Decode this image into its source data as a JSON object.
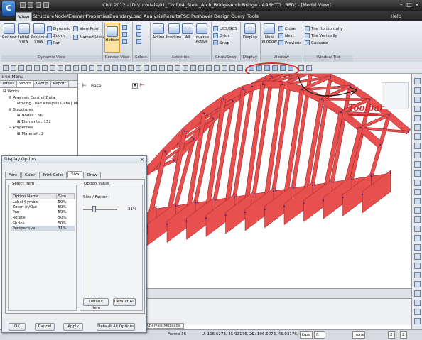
{
  "title_bar": {
    "text": "Civil 2012 - [D:\\tutorials\\01_Civil\\04_Steel_Arch_Bridge\\Arch Bridge - AASHTO LRFD] - [Model View]",
    "help_label": "Help",
    "app_icon_letter": "C"
  },
  "menu_tabs": [
    "View",
    "Structure",
    "Node/Element",
    "Properties",
    "Boundary",
    "Load",
    "Analysis",
    "Results",
    "PSC",
    "Pushover",
    "Design",
    "Query",
    "Tools"
  ],
  "ribbon": {
    "redraw": "Redraw",
    "initial_view": "Initial View",
    "previous_view": "Previous View",
    "dynamic": "Dynamic",
    "zoom": "Zoom",
    "pan": "Pan",
    "view_point": "View Point",
    "named_view": "Named View",
    "hidden": "Hidden",
    "active": "Active",
    "inactive": "Inactive",
    "all": "All",
    "inverse_active": "Inverse Active",
    "ucs_gcs": "UCS/GCS",
    "grids": "Grids",
    "snap": "Snap",
    "display": "Display",
    "new_window": "New Window",
    "close": "Close",
    "next": "Next",
    "previous": "Previous",
    "tile_horizontally": "Tile Horizontally",
    "tile_vertically": "Tile Vertically",
    "cascade": "Cascade",
    "groups": [
      "Dynamic View",
      "Render View",
      "Select",
      "Activities",
      "Grids/Snap",
      "Display",
      "Window",
      "Window Tile"
    ]
  },
  "annotation": {
    "toolbar_label": "Toolbar"
  },
  "tree_menu": {
    "title": "Tree Menu",
    "tabs": [
      "Tables",
      "Works",
      "Group",
      "Report"
    ],
    "active_tab": "Works",
    "items": [
      "Works",
      "Analysis Control Data",
      "Moving Load Analysis Data [ Method",
      "Structures",
      "Nodes : 56",
      "Elements : 132",
      "Properties",
      "Material : 2"
    ]
  },
  "viewport": {
    "view_name": "Base"
  },
  "vp_tabs": {
    "message": "Analysis Message"
  },
  "status_bar": {
    "frame": "Frame-36",
    "u_coord": "U: 106.6273, 45.93176, 29.",
    "g_coord": "G: 106.6273, 45.93176, 29.",
    "force_unit": "kips",
    "length_unit": "ft",
    "filter": "none",
    "page_current": "2",
    "page_total": "2"
  },
  "dialog": {
    "title": "Display Option",
    "tabs": [
      "Font",
      "Color",
      "Print Color",
      "Size",
      "Draw"
    ],
    "active_tab": "Size",
    "select_item_legend": "Select Item",
    "col_option_name": "Option Name",
    "col_size": "Size",
    "rows": [
      {
        "name": "Label Symbol",
        "size": "50%"
      },
      {
        "name": "Zoom In/Out",
        "size": "50%"
      },
      {
        "name": "Pan",
        "size": "50%"
      },
      {
        "name": "Rotate",
        "size": "50%"
      },
      {
        "name": "Shrink",
        "size": "50%"
      },
      {
        "name": "Perspective",
        "size": "31%"
      }
    ],
    "selected_row": 5,
    "option_value_legend": "Option Value",
    "size_factor_label": "Size / Factor :",
    "slider_value": "31%",
    "slider_fraction": 0.31,
    "default_item": "Default Item",
    "default_all": "Default All",
    "ok": "OK",
    "cancel": "Cancel",
    "apply": "Apply",
    "default_all_options": "Default All Options"
  },
  "colors": {
    "bridge_fill": "#e8504f",
    "bridge_edge": "#8e1f1f",
    "highlight": "#d8262b",
    "node": "#2a2aa8"
  }
}
